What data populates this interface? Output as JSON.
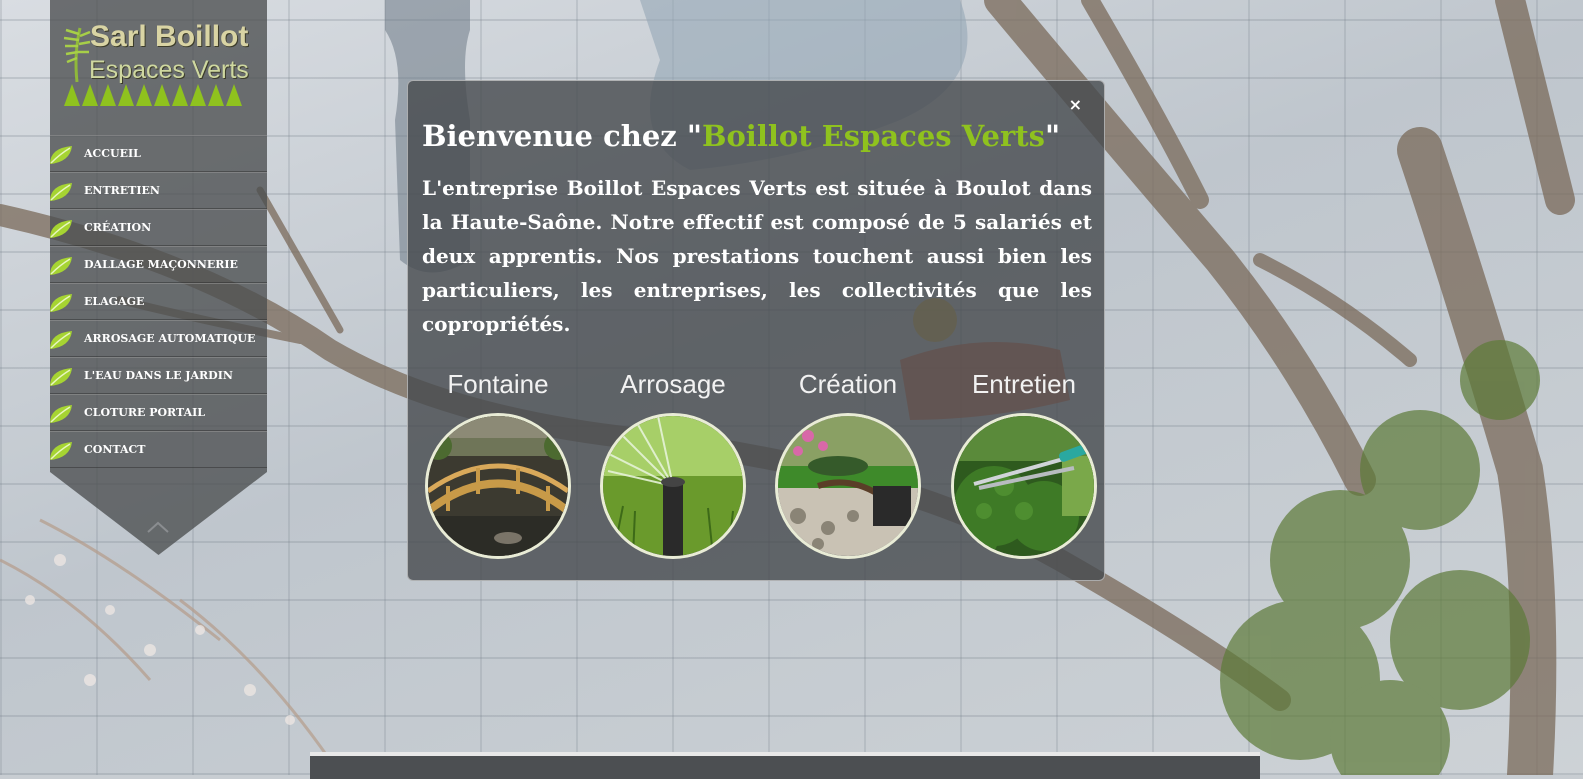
{
  "brand": {
    "line1": "Sarl Boillot",
    "line2": "Espaces Verts",
    "accent_color": "#8fc21e"
  },
  "nav": {
    "items": [
      {
        "label": "ACCUEIL"
      },
      {
        "label": "ENTRETIEN"
      },
      {
        "label": "CRÉATION"
      },
      {
        "label": "DALLAGE MAÇONNERIE"
      },
      {
        "label": "ELAGAGE"
      },
      {
        "label": "ARROSAGE AUTOMATIQUE"
      },
      {
        "label": "L'EAU DANS LE JARDIN"
      },
      {
        "label": "CLOTURE PORTAIL"
      },
      {
        "label": "CONTACT"
      }
    ],
    "collapse_icon": "chevron-up-icon"
  },
  "popup": {
    "close_label": "×",
    "title_prefix": "Bienvenue chez \"",
    "title_highlight": "Boillot Espaces Verts",
    "title_suffix": "\"",
    "body": "L'entreprise Boillot Espaces Verts est située à Boulot dans la Haute-Saône. Notre effectif est composé de 5 salariés et deux apprentis. Nos prestations touchent aussi bien les particuliers, les entreprises, les collectivités que les copropriétés.",
    "services": [
      {
        "label": "Fontaine",
        "image": "wooden-bridge-pond"
      },
      {
        "label": "Arrosage",
        "image": "sprinkler"
      },
      {
        "label": "Création",
        "image": "zen-garden"
      },
      {
        "label": "Entretien",
        "image": "hedge-shears"
      }
    ]
  }
}
